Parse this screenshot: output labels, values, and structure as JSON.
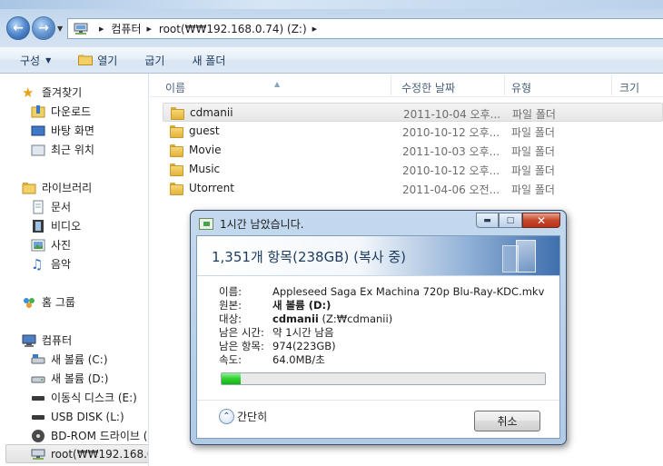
{
  "address": {
    "crumbs": [
      "컴퓨터",
      "root(₩₩192.168.0.74) (Z:)"
    ]
  },
  "toolbar": {
    "organize": "구성",
    "open": "열기",
    "burn": "굽기",
    "new_folder": "새 폴더"
  },
  "sidebar": {
    "favorites": "즐겨찾기",
    "downloads": "다운로드",
    "desktop": "바탕 화면",
    "recent": "최근 위치",
    "libraries": "라이브러리",
    "documents": "문서",
    "videos": "비디오",
    "pictures": "사진",
    "music": "음악",
    "homegroup": "홈 그룹",
    "computer": "컴퓨터",
    "drive_c": "새 볼륨 (C:)",
    "drive_d": "새 볼륨 (D:)",
    "drive_e": "이동식 디스크 (E:)",
    "drive_l": "USB DISK (L:)",
    "bdrom": "BD-ROM 드라이브 (",
    "network": "root(₩₩192.168.0.7"
  },
  "columns": {
    "name": "이름",
    "modified": "수정한 날짜",
    "type": "유형",
    "size": "크기"
  },
  "files": [
    {
      "name": "cdmanii",
      "date": "2011-10-04 오후...",
      "type": "파일 폴더"
    },
    {
      "name": "guest",
      "date": "2010-10-12 오후...",
      "type": "파일 폴더"
    },
    {
      "name": "Movie",
      "date": "2011-10-03 오후...",
      "type": "파일 폴더"
    },
    {
      "name": "Music",
      "date": "2010-10-12 오후...",
      "type": "파일 폴더"
    },
    {
      "name": "Utorrent",
      "date": "2011-04-06 오전...",
      "type": "파일 폴더"
    }
  ],
  "dialog": {
    "title": "1시간 남았습니다.",
    "headline": "1,351개 항목(238GB) (복사 중)",
    "name_label": "이름:",
    "name_value": "Appleseed Saga Ex Machina 720p Blu-Ray-KDC.mkv",
    "from_label": "원본:",
    "from_value": "새 볼륨 (D:)",
    "to_label": "대상:",
    "to_value_bold": "cdmanii",
    "to_value_rest": " (Z:₩cdmanii)",
    "time_label": "남은 시간:",
    "time_value": "약 1시간 남음",
    "items_label": "남은 항목:",
    "items_value": "974(223GB)",
    "speed_label": "속도:",
    "speed_value": "64.0MB/초",
    "progress_fraction": 0.06,
    "less_details": "간단히",
    "cancel": "취소"
  }
}
